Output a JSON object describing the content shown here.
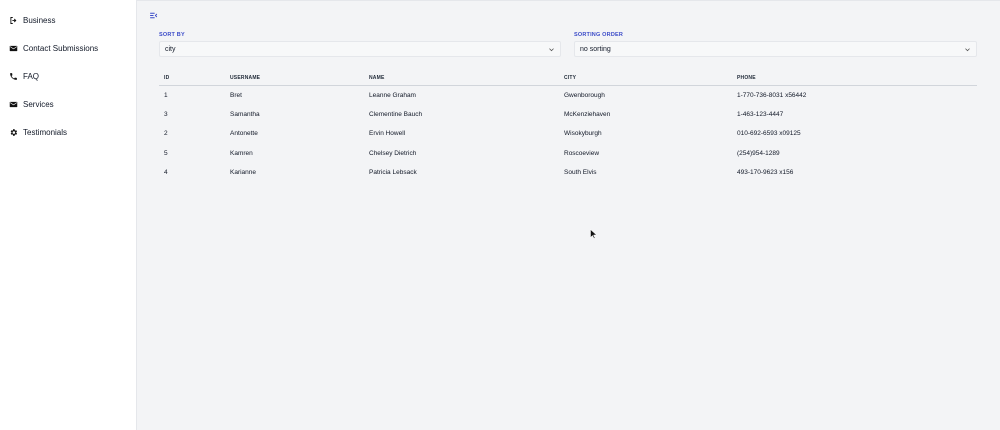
{
  "sidebar": {
    "items": [
      {
        "label": "Business",
        "icon": "logout-icon"
      },
      {
        "label": "Contact Submissions",
        "icon": "mail-icon"
      },
      {
        "label": "FAQ",
        "icon": "phone-icon"
      },
      {
        "label": "Services",
        "icon": "mail-icon"
      },
      {
        "label": "Testimonials",
        "icon": "gear-icon"
      }
    ]
  },
  "filters": {
    "sort_by_label": "SORT BY",
    "sort_by_value": "city",
    "order_label": "SORTING ORDER",
    "order_value": "no sorting"
  },
  "table": {
    "columns": [
      "ID",
      "USERNAME",
      "NAME",
      "CITY",
      "PHONE"
    ],
    "rows": [
      [
        "1",
        "Bret",
        "Leanne Graham",
        "Gwenborough",
        "1-770-736-8031 x56442"
      ],
      [
        "3",
        "Samantha",
        "Clementine Bauch",
        "McKenziehaven",
        "1-463-123-4447"
      ],
      [
        "2",
        "Antonette",
        "Ervin Howell",
        "Wisokyburgh",
        "010-692-6593 x09125"
      ],
      [
        "5",
        "Kamren",
        "Chelsey Dietrich",
        "Roscoeview",
        "(254)954-1289"
      ],
      [
        "4",
        "Karianne",
        "Patricia Lebsack",
        "South Elvis",
        "493-170-9623 x156"
      ]
    ]
  },
  "colors": {
    "accent": "#3b4bc8",
    "background": "#f3f4f6"
  }
}
